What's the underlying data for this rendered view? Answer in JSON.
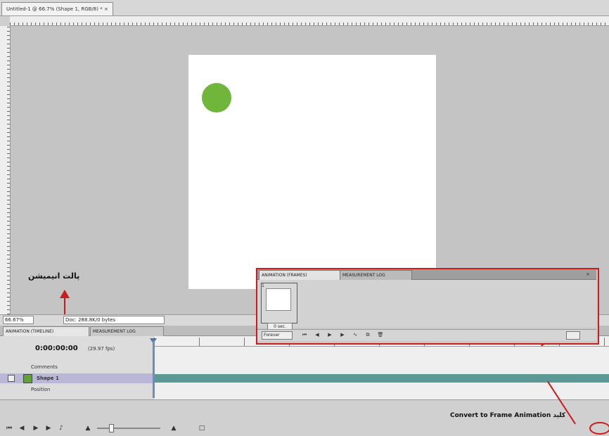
{
  "document_tab": {
    "label": "Untitled-1 @ 66.7% (Shape 1, RGB/8) * ×"
  },
  "status_bar": {
    "zoom": "66.67%",
    "info": "Doc: 288.8K/0 bytes"
  },
  "annotations": {
    "animation_panel": "پالت انیمیشن",
    "convert_to_frame": "Convert to Frame Animation کلید"
  },
  "timeline_panel": {
    "tabs": [
      "ANIMATION (TIMELINE)",
      "MEASUREMENT LOG"
    ],
    "timecode": "0:00:00:00",
    "fps": "(29.97 fps)",
    "rows": [
      {
        "label": "Comments"
      },
      {
        "label": "Shape 1"
      },
      {
        "label": "Position"
      }
    ],
    "icons": [
      "first-frame-icon",
      "prev-frame-icon",
      "play-icon",
      "next-frame-icon",
      "audio-icon",
      "zoom-out-icon",
      "zoom-in-icon",
      "convert-frame-animation-icon"
    ]
  },
  "frame_panel": {
    "tabs": [
      "ANIMATION (FRAMES)",
      "MEASUREMENT LOG"
    ],
    "frame_number": "1",
    "frame_delay": "0 sec.",
    "loop": "Forever",
    "close": "×"
  },
  "colors": {
    "shape": "#6fb63b",
    "highlight": "#cc1b1b",
    "layer_bar": "#5c9994"
  }
}
